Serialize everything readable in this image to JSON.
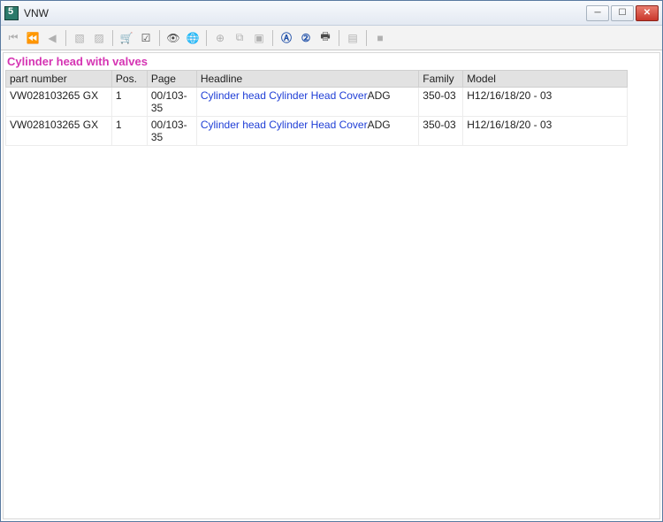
{
  "titlebar": {
    "title": "VNW"
  },
  "toolbar": {
    "icons": [
      {
        "name": "first-icon",
        "glyph": "⏮",
        "cls": "disabled"
      },
      {
        "name": "fast-back-icon",
        "glyph": "⏪",
        "cls": "disabled"
      },
      {
        "name": "back-icon",
        "glyph": "◀",
        "cls": "disabled"
      },
      {
        "name": "sep"
      },
      {
        "name": "page-prev-icon",
        "glyph": "▧",
        "cls": "disabled"
      },
      {
        "name": "page-next-icon",
        "glyph": "▨",
        "cls": "disabled"
      },
      {
        "name": "sep"
      },
      {
        "name": "cart-icon",
        "glyph": "🛒",
        "cls": ""
      },
      {
        "name": "checklist-icon",
        "glyph": "☑",
        "cls": ""
      },
      {
        "name": "sep"
      },
      {
        "name": "hide-icon",
        "glyph": "👁",
        "cls": ""
      },
      {
        "name": "globe-icon",
        "glyph": "🌐",
        "cls": ""
      },
      {
        "name": "sep"
      },
      {
        "name": "zoom-in-icon",
        "glyph": "⊕",
        "cls": "disabled"
      },
      {
        "name": "copy-icon",
        "glyph": "⧉",
        "cls": "disabled"
      },
      {
        "name": "window-icon",
        "glyph": "▣",
        "cls": "disabled"
      },
      {
        "name": "sep"
      },
      {
        "name": "circle-a-icon",
        "glyph": "Ⓐ",
        "cls": "blue"
      },
      {
        "name": "circle-2-icon",
        "glyph": "②",
        "cls": "blue"
      },
      {
        "name": "print-icon",
        "glyph": "🖶",
        "cls": ""
      },
      {
        "name": "sep"
      },
      {
        "name": "note-icon",
        "glyph": "▤",
        "cls": "disabled"
      },
      {
        "name": "sep"
      },
      {
        "name": "stop-icon",
        "glyph": "■",
        "cls": "disabled"
      }
    ]
  },
  "section": {
    "title": "Cylinder head with valves"
  },
  "columns": {
    "part": "part number",
    "pos": "Pos.",
    "page": "Page",
    "headline": "Headline",
    "family": "Family",
    "model": "Model"
  },
  "rows": [
    {
      "part": "VW028103265 GX",
      "pos": "1",
      "page": "00/103-35",
      "headline_link": "Cylinder head Cylinder Head Cover",
      "headline_tail": "ADG",
      "family": "350-03",
      "model": "H12/16/18/20 - 03"
    },
    {
      "part": "VW028103265 GX",
      "pos": "1",
      "page": "00/103-35",
      "headline_link": "Cylinder head Cylinder Head Cover",
      "headline_tail": "ADG",
      "family": "350-03",
      "model": "H12/16/18/20 - 03"
    }
  ]
}
